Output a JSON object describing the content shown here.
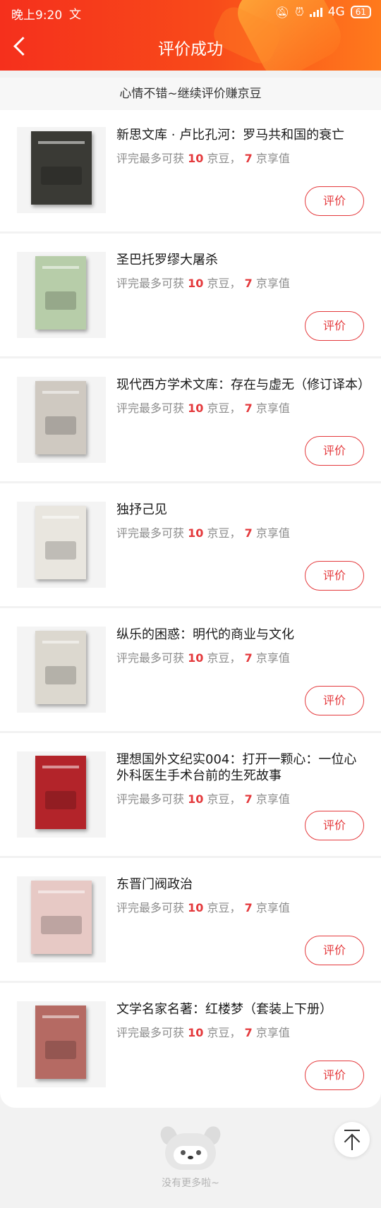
{
  "status_bar": {
    "time": "晚上9:20",
    "network": "4G",
    "battery": "61"
  },
  "nav": {
    "title": "评价成功"
  },
  "banner": {
    "text": "心情不错~继续评价赚京豆"
  },
  "reward_text": {
    "prefix": "评完最多可获",
    "beans_unit": "京豆，",
    "value_unit": "京享值"
  },
  "items": [
    {
      "title": "新思文库 · 卢比孔河：罗马共和国的衰亡",
      "beans": "10",
      "value": "7",
      "button": "评价",
      "cover_color": "#3a3a35"
    },
    {
      "title": "圣巴托罗缪大屠杀",
      "beans": "10",
      "value": "7",
      "button": "评价",
      "cover_color": "#b7cda9"
    },
    {
      "title": "现代西方学术文库：存在与虚无（修订译本）",
      "beans": "10",
      "value": "7",
      "button": "评价",
      "cover_color": "#cfc9c1"
    },
    {
      "title": "独抒己见",
      "beans": "10",
      "value": "7",
      "button": "评价",
      "cover_color": "#e9e6df"
    },
    {
      "title": "纵乐的困惑：明代的商业与文化",
      "beans": "10",
      "value": "7",
      "button": "评价",
      "cover_color": "#dcd8cf"
    },
    {
      "title": "理想国外文纪实004：打开一颗心：一位心外科医生手术台前的生死故事",
      "beans": "10",
      "value": "7",
      "button": "评价",
      "cover_color": "#b3242a"
    },
    {
      "title": "东晋门阀政治",
      "beans": "10",
      "value": "7",
      "button": "评价",
      "cover_color": "#e7c9c5"
    },
    {
      "title": "文学名家名著：红楼梦（套装上下册）",
      "beans": "10",
      "value": "7",
      "button": "评价",
      "cover_color": "#b56a63"
    }
  ],
  "footer": {
    "text": "没有更多啦~"
  }
}
